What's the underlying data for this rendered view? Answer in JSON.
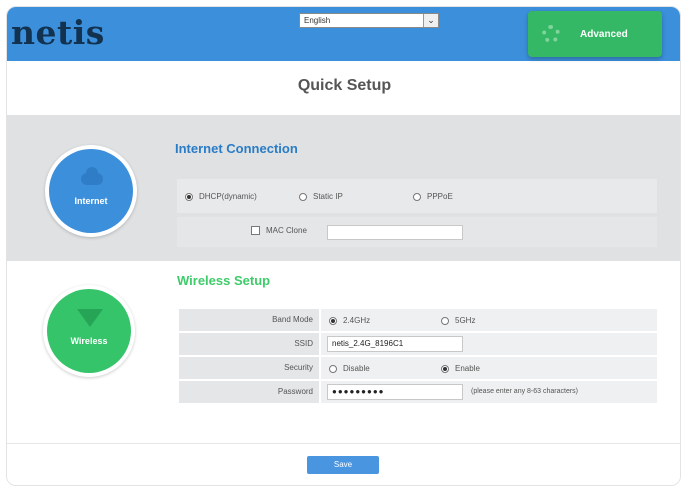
{
  "brand": {
    "logo": "netis"
  },
  "header": {
    "language": "English",
    "advanced_label": "Advanced"
  },
  "title": "Quick Setup",
  "internet": {
    "circle_label": "Internet",
    "section_title": "Internet Connection",
    "options": [
      "DHCP(dynamic)",
      "Static IP",
      "PPPoE"
    ],
    "selected": "DHCP(dynamic)",
    "mac_clone_label": "MAC Clone",
    "mac_clone_checked": false,
    "mac_clone_value": ""
  },
  "wireless": {
    "circle_label": "Wireless",
    "section_title": "Wireless Setup",
    "band_mode": {
      "label": "Band Mode",
      "options": [
        "2.4GHz",
        "5GHz"
      ],
      "selected": "2.4GHz"
    },
    "ssid": {
      "label": "SSID",
      "value": "netis_2.4G_8196C1"
    },
    "security": {
      "label": "Security",
      "options": [
        "Disable",
        "Enable"
      ],
      "selected": "Enable"
    },
    "password": {
      "label": "Password",
      "value": "●●●●●●●●●",
      "hint": "(please enter any 8-63 characters)"
    }
  },
  "footer": {
    "save_label": "Save"
  },
  "colors": {
    "header_blue": "#3b8fdb",
    "advanced_green": "#35b866",
    "internet_title_blue": "#2a7cc7",
    "wireless_title_green": "#3fcb6a",
    "save_blue": "#4a95e0"
  }
}
